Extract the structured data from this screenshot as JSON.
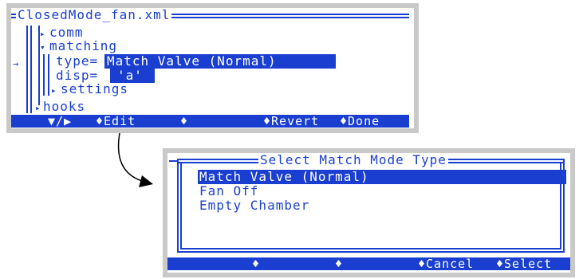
{
  "left_panel": {
    "title": "ClosedMode_fan.xml",
    "tree": {
      "comm": "comm",
      "matching": "matching",
      "type_label": "type=",
      "type_value": "Match Valve (Normal)",
      "disp_label": "disp=",
      "disp_value": "'a'",
      "settings": "settings",
      "hooks": "hooks"
    },
    "function_bar": {
      "f1": "▼/▶",
      "f2": "♦Edit",
      "f3": "♦",
      "f4": "♦Revert",
      "f5": "♦Done"
    }
  },
  "right_panel": {
    "title": "Select Match Mode Type",
    "options": [
      "Match Valve (Normal)",
      "Fan Off",
      "Empty Chamber"
    ],
    "selected_index": 0,
    "function_bar": {
      "f1": "♦",
      "f2": "♦",
      "f3": "♦Cancel",
      "f4": "♦Select"
    }
  },
  "colors": {
    "accent": "#1a3fd0",
    "frame": "#c9c9c9",
    "background": "#ffffff"
  }
}
